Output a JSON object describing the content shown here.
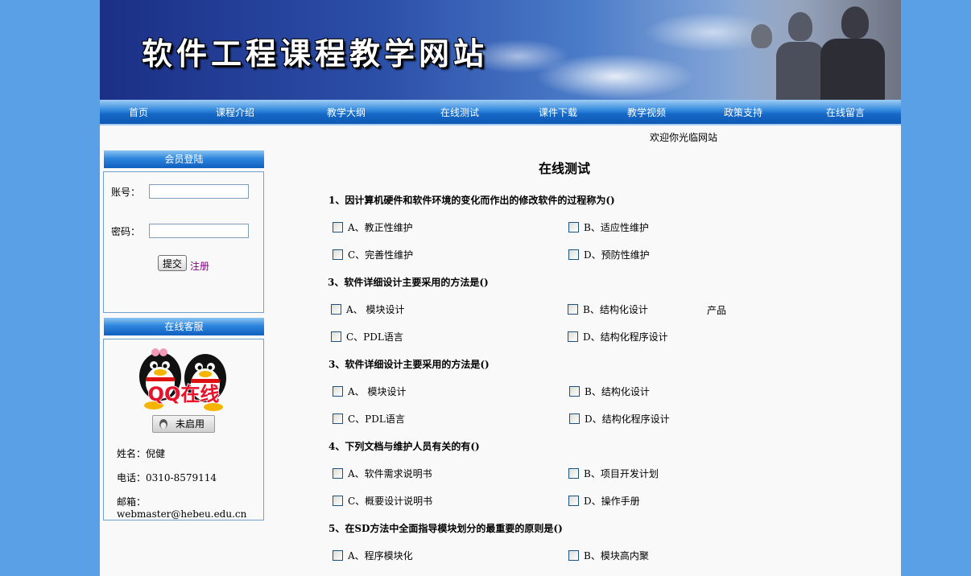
{
  "site": {
    "title": "软件工程课程教学网站"
  },
  "nav": [
    "首页",
    "课程介绍",
    "教学大纲",
    "在线测试",
    "课件下载",
    "教学视频",
    "政策支持",
    "在线留言"
  ],
  "welcome": "欢迎你光临网站",
  "login": {
    "header": "会员登陆",
    "account_label": "账号：",
    "password_label": "密码：",
    "account_value": "",
    "password_value": "",
    "submit_label": "提交",
    "register_label": "注册"
  },
  "service": {
    "header": "在线客服",
    "qq_badge_text": "QQ在线",
    "status": "未启用",
    "name": "姓名：倪健",
    "phone": "电话：0310-8579114",
    "email": "邮箱：webmaster@hebeu.edu.cn"
  },
  "quiz": {
    "title": "在线测试",
    "extra_label": "产品",
    "questions": [
      {
        "text": "1、因计算机硬件和软件环境的变化而作出的修改软件的过程称为()",
        "options": [
          "A、教正性维护",
          "B、适应性维护",
          "C、完善性维护",
          "D、预防性维护"
        ]
      },
      {
        "text": "3、软件详细设计主要采用的方法是()",
        "options": [
          "A、 模块设计",
          "B、结构化设计",
          "C、PDL语言",
          "D、结构化程序设计"
        ]
      },
      {
        "text": "3、软件详细设计主要采用的方法是()",
        "options": [
          "A、 模块设计",
          "B、结构化设计",
          "C、PDL语言",
          "D、结构化程序设计"
        ]
      },
      {
        "text": "4、下列文档与维护人员有关的有()",
        "options": [
          "A、软件需求说明书",
          "B、项目开发计划",
          "C、概要设计说明书",
          "D、操作手册"
        ]
      },
      {
        "text": "5、在SD方法中全面指导模块划分的最重要的原则是()",
        "options": [
          "A、程序模块化",
          "B、模块高内聚"
        ]
      }
    ]
  },
  "colors": {
    "background": "#5aa0e6",
    "nav": "#1569c7",
    "link_visited": "#800080"
  }
}
